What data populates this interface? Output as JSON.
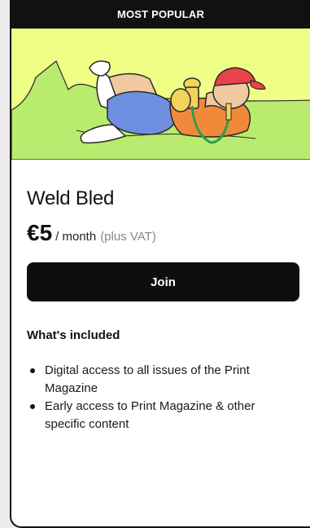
{
  "badge": {
    "label": "MOST POPULAR"
  },
  "plan": {
    "name": "Weld Bled",
    "price": "€5",
    "period": "/ month",
    "tax_note": "(plus VAT)"
  },
  "join_button": {
    "label": "Join"
  },
  "included": {
    "title": "What's included",
    "features": [
      "Digital access to all issues of the Print Magazine",
      "Early access to Print Magazine & other specific content"
    ]
  },
  "colors": {
    "hero_background": "#efff86",
    "hills": "#b8eb6e",
    "button": "#0e0e0e",
    "badge": "#111111"
  },
  "icons": {
    "hero_illustration": "man-smoking-hookah-illustration"
  }
}
